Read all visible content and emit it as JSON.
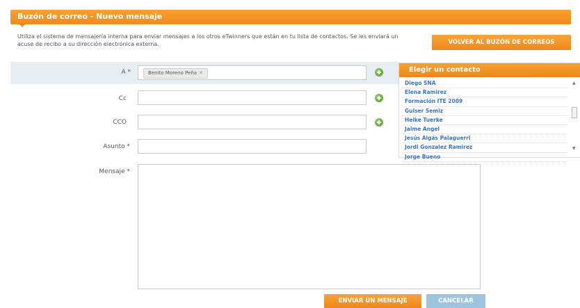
{
  "header": {
    "title": "Buzón de correo - Nuevo mensaje"
  },
  "intro": {
    "text": "Utiliza el sistema de mensajería interna para enviar mensajes a los otros eTwinners que están en tu lista de contactos. Se les enviará un acuse de recibo a su dirección electrónica externa."
  },
  "back_button": {
    "label": "VOLVER AL BUZÓN DE CORREOS"
  },
  "form": {
    "to": {
      "label": "A *",
      "recipient": "Benito Moreno Peña",
      "remove": "✕"
    },
    "cc": {
      "label": "Cc",
      "value": ""
    },
    "bcc": {
      "label": "CCO",
      "value": ""
    },
    "subject": {
      "label": "Asunto *",
      "value": ""
    },
    "message": {
      "label": "Mensaje *",
      "value": ""
    }
  },
  "contacts": {
    "title": "Elegir un contacto",
    "items": [
      "Diego SNA",
      "Elena Ramirez",
      "Formación ITE 2009",
      "Gulser Semiz",
      "Heike Tuerke",
      "Jaime Angel",
      "Jesús Algás Palaguerri",
      "Jordi Gonzalez Ramirez",
      "Jorge Bueno"
    ]
  },
  "actions": {
    "send": "ENVIAR UN MENSAJE",
    "cancel": "CANCELAR"
  },
  "colors": {
    "accent": "#f08a1c",
    "link": "#3a76bd",
    "cancel": "#9fc4de",
    "highlight_row": "#e7eef3"
  },
  "icons": {
    "add": "plus-circle-icon",
    "scroll_up": "arrow-up-icon",
    "scroll_down": "arrow-down-icon"
  }
}
